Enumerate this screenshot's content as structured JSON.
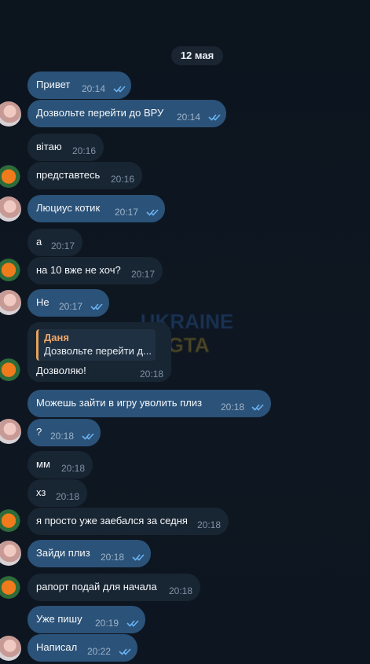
{
  "date_separator": "12 мая",
  "watermark": {
    "line1": "UKRAINE",
    "line2": "GTA"
  },
  "messages": [
    {
      "text": "Привет",
      "time": "20:14"
    },
    {
      "text": "Дозвольте перейти до ВРУ",
      "time": "20:14"
    },
    {
      "text": "вітаю",
      "time": "20:16"
    },
    {
      "text": "представтесь",
      "time": "20:16"
    },
    {
      "text": "Люциус котик",
      "time": "20:17"
    },
    {
      "text": "а",
      "time": "20:17"
    },
    {
      "text": "на 10 вже не хоч?",
      "time": "20:17"
    },
    {
      "text": "Не",
      "time": "20:17"
    },
    {
      "text": "Можешь зайти в игру уволить плиз",
      "time": "20:18"
    },
    {
      "text": "?",
      "time": "20:18"
    },
    {
      "text": "мм",
      "time": "20:18"
    },
    {
      "text": "хз",
      "time": "20:18"
    },
    {
      "text": "я просто уже заебался за седня",
      "time": "20:18"
    },
    {
      "text": "Зайди плиз",
      "time": "20:18"
    },
    {
      "text": "рапорт подай для начала",
      "time": "20:18"
    },
    {
      "text": "Уже пишу",
      "time": "20:19"
    },
    {
      "text": "Написал",
      "time": "20:22"
    }
  ],
  "reply_message": {
    "quote_author": "Даня",
    "quote_text": "Дозвольте перейти д...",
    "text": "Дозволяю!",
    "time": "20:18"
  },
  "colors": {
    "background": "#0e1621",
    "outgoing_bubble": "#2b5278",
    "incoming_bubble": "#182533",
    "quote_accent": "#e6a35a",
    "read_ticks": "#6ab3f3"
  }
}
